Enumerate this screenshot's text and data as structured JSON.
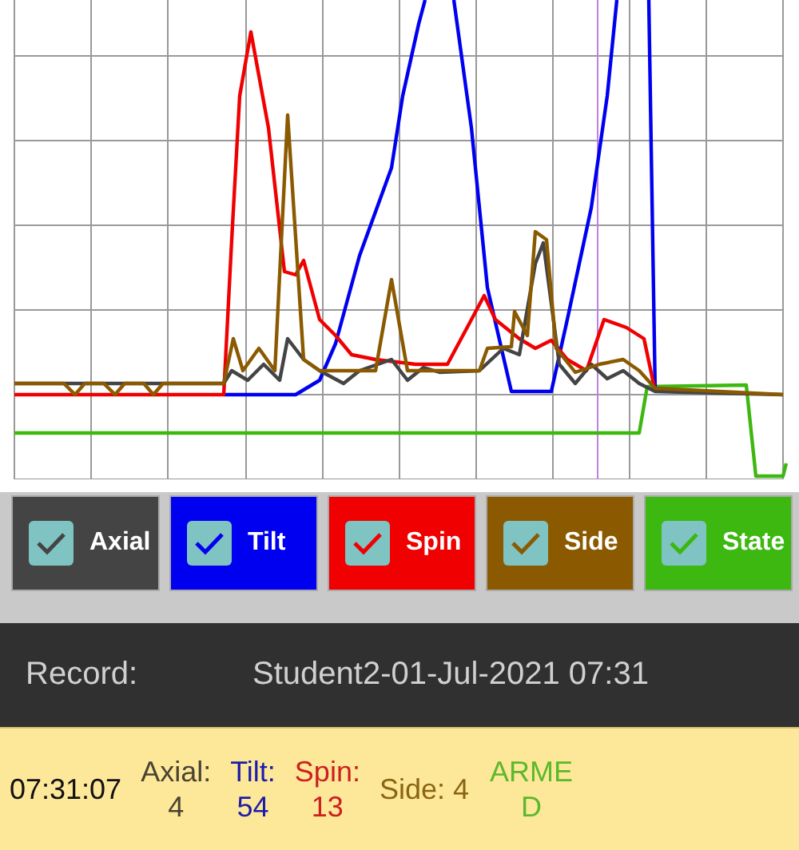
{
  "legend": [
    {
      "label": "Axial",
      "checked": true,
      "color": "#444444"
    },
    {
      "label": "Tilt",
      "checked": true,
      "color": "#0000f0"
    },
    {
      "label": "Spin",
      "checked": true,
      "color": "#f00000"
    },
    {
      "label": "Side",
      "checked": true,
      "color": "#8b5a00"
    },
    {
      "label": "State",
      "checked": true,
      "color": "#3cb811"
    }
  ],
  "record": {
    "label": "Record:",
    "value": "Student2-01-Jul-2021 07:31"
  },
  "readout": {
    "time": "07:31:07",
    "items": [
      {
        "kind": "stacked",
        "label": "Axial:",
        "value": "4",
        "color": "#4a4232"
      },
      {
        "kind": "stacked",
        "label": "Tilt:",
        "value": "54",
        "color": "#1c1ca8"
      },
      {
        "kind": "stacked",
        "label": "Spin:",
        "value": "13",
        "color": "#cc1f1f"
      },
      {
        "kind": "inline",
        "label": "Side:",
        "value": "4",
        "color": "#8b6414"
      },
      {
        "kind": "state",
        "value": "ARMED",
        "color": "#5cb82c"
      }
    ]
  }
}
